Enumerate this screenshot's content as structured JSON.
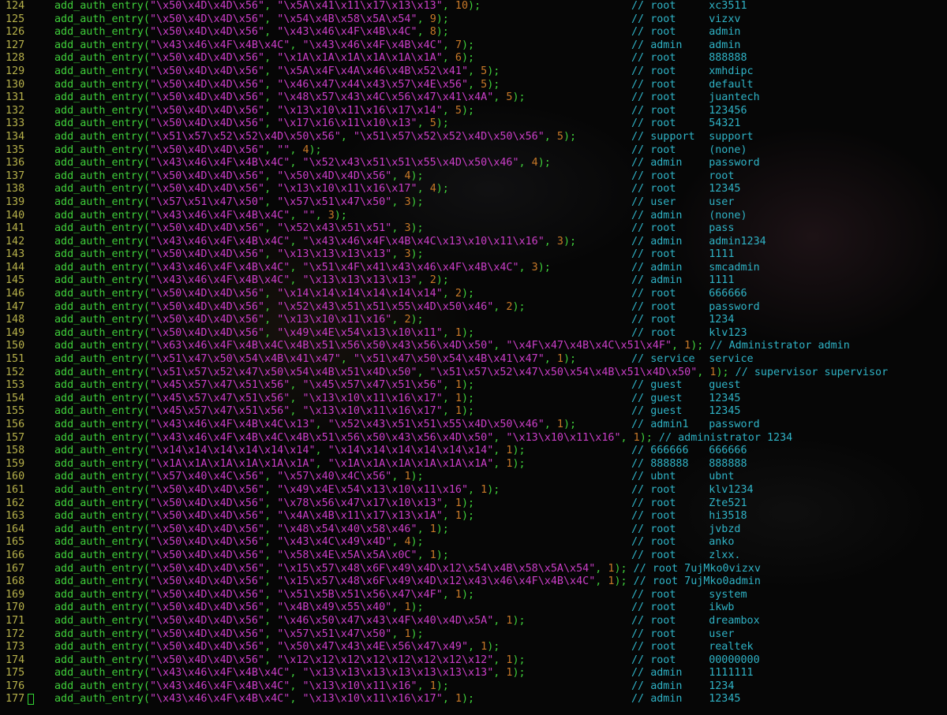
{
  "colors": {
    "line_number": "#b6b04a",
    "function": "#3fd03a",
    "string": "#cb3ec8",
    "number": "#c97a28",
    "comment": "#2fb3c6",
    "background": "#060606",
    "cursor": "#33d633"
  },
  "editor": {
    "function_name": "add_auth_entry",
    "cursor_line": 177,
    "lines": [
      {
        "n": "124",
        "u": "\\x50\\x4D\\x4D\\x56",
        "p": "\\x5A\\x41\\x11\\x17\\x13\\x13",
        "w": "10",
        "cu": "root",
        "cp": "xc3511",
        "inline": false
      },
      {
        "n": "125",
        "u": "\\x50\\x4D\\x4D\\x56",
        "p": "\\x54\\x4B\\x58\\x5A\\x54",
        "w": "9",
        "cu": "root",
        "cp": "vizxv",
        "inline": false
      },
      {
        "n": "126",
        "u": "\\x50\\x4D\\x4D\\x56",
        "p": "\\x43\\x46\\x4F\\x4B\\x4C",
        "w": "8",
        "cu": "root",
        "cp": "admin",
        "inline": false
      },
      {
        "n": "127",
        "u": "\\x43\\x46\\x4F\\x4B\\x4C",
        "p": "\\x43\\x46\\x4F\\x4B\\x4C",
        "w": "7",
        "cu": "admin",
        "cp": "admin",
        "inline": false
      },
      {
        "n": "128",
        "u": "\\x50\\x4D\\x4D\\x56",
        "p": "\\x1A\\x1A\\x1A\\x1A\\x1A\\x1A",
        "w": "6",
        "cu": "root",
        "cp": "888888",
        "inline": false
      },
      {
        "n": "129",
        "u": "\\x50\\x4D\\x4D\\x56",
        "p": "\\x5A\\x4F\\x4A\\x46\\x4B\\x52\\x41",
        "w": "5",
        "cu": "root",
        "cp": "xmhdipc",
        "inline": false
      },
      {
        "n": "130",
        "u": "\\x50\\x4D\\x4D\\x56",
        "p": "\\x46\\x47\\x44\\x43\\x57\\x4E\\x56",
        "w": "5",
        "cu": "root",
        "cp": "default",
        "inline": false
      },
      {
        "n": "131",
        "u": "\\x50\\x4D\\x4D\\x56",
        "p": "\\x48\\x57\\x43\\x4C\\x56\\x47\\x41\\x4A",
        "w": "5",
        "cu": "root",
        "cp": "juantech",
        "inline": false
      },
      {
        "n": "132",
        "u": "\\x50\\x4D\\x4D\\x56",
        "p": "\\x13\\x10\\x11\\x16\\x17\\x14",
        "w": "5",
        "cu": "root",
        "cp": "123456",
        "inline": false
      },
      {
        "n": "133",
        "u": "\\x50\\x4D\\x4D\\x56",
        "p": "\\x17\\x16\\x11\\x10\\x13",
        "w": "5",
        "cu": "root",
        "cp": "54321",
        "inline": false
      },
      {
        "n": "134",
        "u": "\\x51\\x57\\x52\\x52\\x4D\\x50\\x56",
        "p": "\\x51\\x57\\x52\\x52\\x4D\\x50\\x56",
        "w": "5",
        "cu": "support",
        "cp": "support",
        "inline": false
      },
      {
        "n": "135",
        "u": "\\x50\\x4D\\x4D\\x56",
        "p": "",
        "w": "4",
        "cu": "root",
        "cp": "(none)",
        "inline": false
      },
      {
        "n": "136",
        "u": "\\x43\\x46\\x4F\\x4B\\x4C",
        "p": "\\x52\\x43\\x51\\x51\\x55\\x4D\\x50\\x46",
        "w": "4",
        "cu": "admin",
        "cp": "password",
        "inline": false
      },
      {
        "n": "137",
        "u": "\\x50\\x4D\\x4D\\x56",
        "p": "\\x50\\x4D\\x4D\\x56",
        "w": "4",
        "cu": "root",
        "cp": "root",
        "inline": false
      },
      {
        "n": "138",
        "u": "\\x50\\x4D\\x4D\\x56",
        "p": "\\x13\\x10\\x11\\x16\\x17",
        "w": "4",
        "cu": "root",
        "cp": "12345",
        "inline": false
      },
      {
        "n": "139",
        "u": "\\x57\\x51\\x47\\x50",
        "p": "\\x57\\x51\\x47\\x50",
        "w": "3",
        "cu": "user",
        "cp": "user",
        "inline": false
      },
      {
        "n": "140",
        "u": "\\x43\\x46\\x4F\\x4B\\x4C",
        "p": "",
        "w": "3",
        "cu": "admin",
        "cp": "(none)",
        "inline": false
      },
      {
        "n": "141",
        "u": "\\x50\\x4D\\x4D\\x56",
        "p": "\\x52\\x43\\x51\\x51",
        "w": "3",
        "cu": "root",
        "cp": "pass",
        "inline": false
      },
      {
        "n": "142",
        "u": "\\x43\\x46\\x4F\\x4B\\x4C",
        "p": "\\x43\\x46\\x4F\\x4B\\x4C\\x13\\x10\\x11\\x16",
        "w": "3",
        "cu": "admin",
        "cp": "admin1234",
        "inline": false
      },
      {
        "n": "143",
        "u": "\\x50\\x4D\\x4D\\x56",
        "p": "\\x13\\x13\\x13\\x13",
        "w": "3",
        "cu": "root",
        "cp": "1111",
        "inline": false
      },
      {
        "n": "144",
        "u": "\\x43\\x46\\x4F\\x4B\\x4C",
        "p": "\\x51\\x4F\\x41\\x43\\x46\\x4F\\x4B\\x4C",
        "w": "3",
        "cu": "admin",
        "cp": "smcadmin",
        "inline": false
      },
      {
        "n": "145",
        "u": "\\x43\\x46\\x4F\\x4B\\x4C",
        "p": "\\x13\\x13\\x13\\x13",
        "w": "2",
        "cu": "admin",
        "cp": "1111",
        "inline": false
      },
      {
        "n": "146",
        "u": "\\x50\\x4D\\x4D\\x56",
        "p": "\\x14\\x14\\x14\\x14\\x14\\x14",
        "w": "2",
        "cu": "root",
        "cp": "666666",
        "inline": false
      },
      {
        "n": "147",
        "u": "\\x50\\x4D\\x4D\\x56",
        "p": "\\x52\\x43\\x51\\x51\\x55\\x4D\\x50\\x46",
        "w": "2",
        "cu": "root",
        "cp": "password",
        "inline": false
      },
      {
        "n": "148",
        "u": "\\x50\\x4D\\x4D\\x56",
        "p": "\\x13\\x10\\x11\\x16",
        "w": "2",
        "cu": "root",
        "cp": "1234",
        "inline": false
      },
      {
        "n": "149",
        "u": "\\x50\\x4D\\x4D\\x56",
        "p": "\\x49\\x4E\\x54\\x13\\x10\\x11",
        "w": "1",
        "cu": "root",
        "cp": "klv123",
        "inline": false
      },
      {
        "n": "150",
        "u": "\\x63\\x46\\x4F\\x4B\\x4C\\x4B\\x51\\x56\\x50\\x43\\x56\\x4D\\x50",
        "p": "\\x4F\\x47\\x4B\\x4C\\x51\\x4F",
        "w": "1",
        "cu": "Administrator",
        "cp": "admin",
        "inline": true
      },
      {
        "n": "151",
        "u": "\\x51\\x47\\x50\\x54\\x4B\\x41\\x47",
        "p": "\\x51\\x47\\x50\\x54\\x4B\\x41\\x47",
        "w": "1",
        "cu": "service",
        "cp": "service",
        "inline": false
      },
      {
        "n": "152",
        "u": "\\x51\\x57\\x52\\x47\\x50\\x54\\x4B\\x51\\x4D\\x50",
        "p": "\\x51\\x57\\x52\\x47\\x50\\x54\\x4B\\x51\\x4D\\x50",
        "w": "1",
        "cu": "supervisor",
        "cp": "supervisor",
        "inline": true
      },
      {
        "n": "153",
        "u": "\\x45\\x57\\x47\\x51\\x56",
        "p": "\\x45\\x57\\x47\\x51\\x56",
        "w": "1",
        "cu": "guest",
        "cp": "guest",
        "inline": false
      },
      {
        "n": "154",
        "u": "\\x45\\x57\\x47\\x51\\x56",
        "p": "\\x13\\x10\\x11\\x16\\x17",
        "w": "1",
        "cu": "guest",
        "cp": "12345",
        "inline": false
      },
      {
        "n": "155",
        "u": "\\x45\\x57\\x47\\x51\\x56",
        "p": "\\x13\\x10\\x11\\x16\\x17",
        "w": "1",
        "cu": "guest",
        "cp": "12345",
        "inline": false
      },
      {
        "n": "156",
        "u": "\\x43\\x46\\x4F\\x4B\\x4C\\x13",
        "p": "\\x52\\x43\\x51\\x51\\x55\\x4D\\x50\\x46",
        "w": "1",
        "cu": "admin1",
        "cp": "password",
        "inline": false
      },
      {
        "n": "157",
        "u": "\\x43\\x46\\x4F\\x4B\\x4C\\x4B\\x51\\x56\\x50\\x43\\x56\\x4D\\x50",
        "p": "\\x13\\x10\\x11\\x16",
        "w": "1",
        "cu": "administrator",
        "cp": "1234",
        "inline": true
      },
      {
        "n": "158",
        "u": "\\x14\\x14\\x14\\x14\\x14\\x14",
        "p": "\\x14\\x14\\x14\\x14\\x14\\x14",
        "w": "1",
        "cu": "666666",
        "cp": "666666",
        "inline": false
      },
      {
        "n": "159",
        "u": "\\x1A\\x1A\\x1A\\x1A\\x1A\\x1A",
        "p": "\\x1A\\x1A\\x1A\\x1A\\x1A\\x1A",
        "w": "1",
        "cu": "888888",
        "cp": "888888",
        "inline": false
      },
      {
        "n": "160",
        "u": "\\x57\\x40\\x4C\\x56",
        "p": "\\x57\\x40\\x4C\\x56",
        "w": "1",
        "cu": "ubnt",
        "cp": "ubnt",
        "inline": false
      },
      {
        "n": "161",
        "u": "\\x50\\x4D\\x4D\\x56",
        "p": "\\x49\\x4E\\x54\\x13\\x10\\x11\\x16",
        "w": "1",
        "cu": "root",
        "cp": "klv1234",
        "inline": false
      },
      {
        "n": "162",
        "u": "\\x50\\x4D\\x4D\\x56",
        "p": "\\x78\\x56\\x47\\x17\\x10\\x13",
        "w": "1",
        "cu": "root",
        "cp": "Zte521",
        "inline": false
      },
      {
        "n": "163",
        "u": "\\x50\\x4D\\x4D\\x56",
        "p": "\\x4A\\x4B\\x11\\x17\\x13\\x1A",
        "w": "1",
        "cu": "root",
        "cp": "hi3518",
        "inline": false
      },
      {
        "n": "164",
        "u": "\\x50\\x4D\\x4D\\x56",
        "p": "\\x48\\x54\\x40\\x58\\x46",
        "w": "1",
        "cu": "root",
        "cp": "jvbzd",
        "inline": false
      },
      {
        "n": "165",
        "u": "\\x50\\x4D\\x4D\\x56",
        "p": "\\x43\\x4C\\x49\\x4D",
        "w": "4",
        "cu": "root",
        "cp": "anko",
        "inline": false
      },
      {
        "n": "166",
        "u": "\\x50\\x4D\\x4D\\x56",
        "p": "\\x58\\x4E\\x5A\\x5A\\x0C",
        "w": "1",
        "cu": "root",
        "cp": "zlxx.",
        "inline": false
      },
      {
        "n": "167",
        "u": "\\x50\\x4D\\x4D\\x56",
        "p": "\\x15\\x57\\x48\\x6F\\x49\\x4D\\x12\\x54\\x4B\\x58\\x5A\\x54",
        "w": "1",
        "cu": "root",
        "cp": "7ujMko0vizxv",
        "inline": true
      },
      {
        "n": "168",
        "u": "\\x50\\x4D\\x4D\\x56",
        "p": "\\x15\\x57\\x48\\x6F\\x49\\x4D\\x12\\x43\\x46\\x4F\\x4B\\x4C",
        "w": "1",
        "cu": "root",
        "cp": "7ujMko0admin",
        "inline": true
      },
      {
        "n": "169",
        "u": "\\x50\\x4D\\x4D\\x56",
        "p": "\\x51\\x5B\\x51\\x56\\x47\\x4F",
        "w": "1",
        "cu": "root",
        "cp": "system",
        "inline": false
      },
      {
        "n": "170",
        "u": "\\x50\\x4D\\x4D\\x56",
        "p": "\\x4B\\x49\\x55\\x40",
        "w": "1",
        "cu": "root",
        "cp": "ikwb",
        "inline": false
      },
      {
        "n": "171",
        "u": "\\x50\\x4D\\x4D\\x56",
        "p": "\\x46\\x50\\x47\\x43\\x4F\\x40\\x4D\\x5A",
        "w": "1",
        "cu": "root",
        "cp": "dreambox",
        "inline": false
      },
      {
        "n": "172",
        "u": "\\x50\\x4D\\x4D\\x56",
        "p": "\\x57\\x51\\x47\\x50",
        "w": "1",
        "cu": "root",
        "cp": "user",
        "inline": false
      },
      {
        "n": "173",
        "u": "\\x50\\x4D\\x4D\\x56",
        "p": "\\x50\\x47\\x43\\x4E\\x56\\x47\\x49",
        "w": "1",
        "cu": "root",
        "cp": "realtek",
        "inline": false
      },
      {
        "n": "174",
        "u": "\\x50\\x4D\\x4D\\x56",
        "p": "\\x12\\x12\\x12\\x12\\x12\\x12\\x12\\x12",
        "w": "1",
        "cu": "root",
        "cp": "00000000",
        "inline": false
      },
      {
        "n": "175",
        "u": "\\x43\\x46\\x4F\\x4B\\x4C",
        "p": "\\x13\\x13\\x13\\x13\\x13\\x13\\x13",
        "w": "1",
        "cu": "admin",
        "cp": "1111111",
        "inline": false
      },
      {
        "n": "176",
        "u": "\\x43\\x46\\x4F\\x4B\\x4C",
        "p": "\\x13\\x10\\x11\\x16",
        "w": "1",
        "cu": "admin",
        "cp": "1234",
        "inline": false
      },
      {
        "n": "177",
        "u": "\\x43\\x46\\x4F\\x4B\\x4C",
        "p": "\\x13\\x10\\x11\\x16\\x17",
        "w": "1",
        "cu": "admin",
        "cp": "12345",
        "inline": false
      }
    ]
  }
}
